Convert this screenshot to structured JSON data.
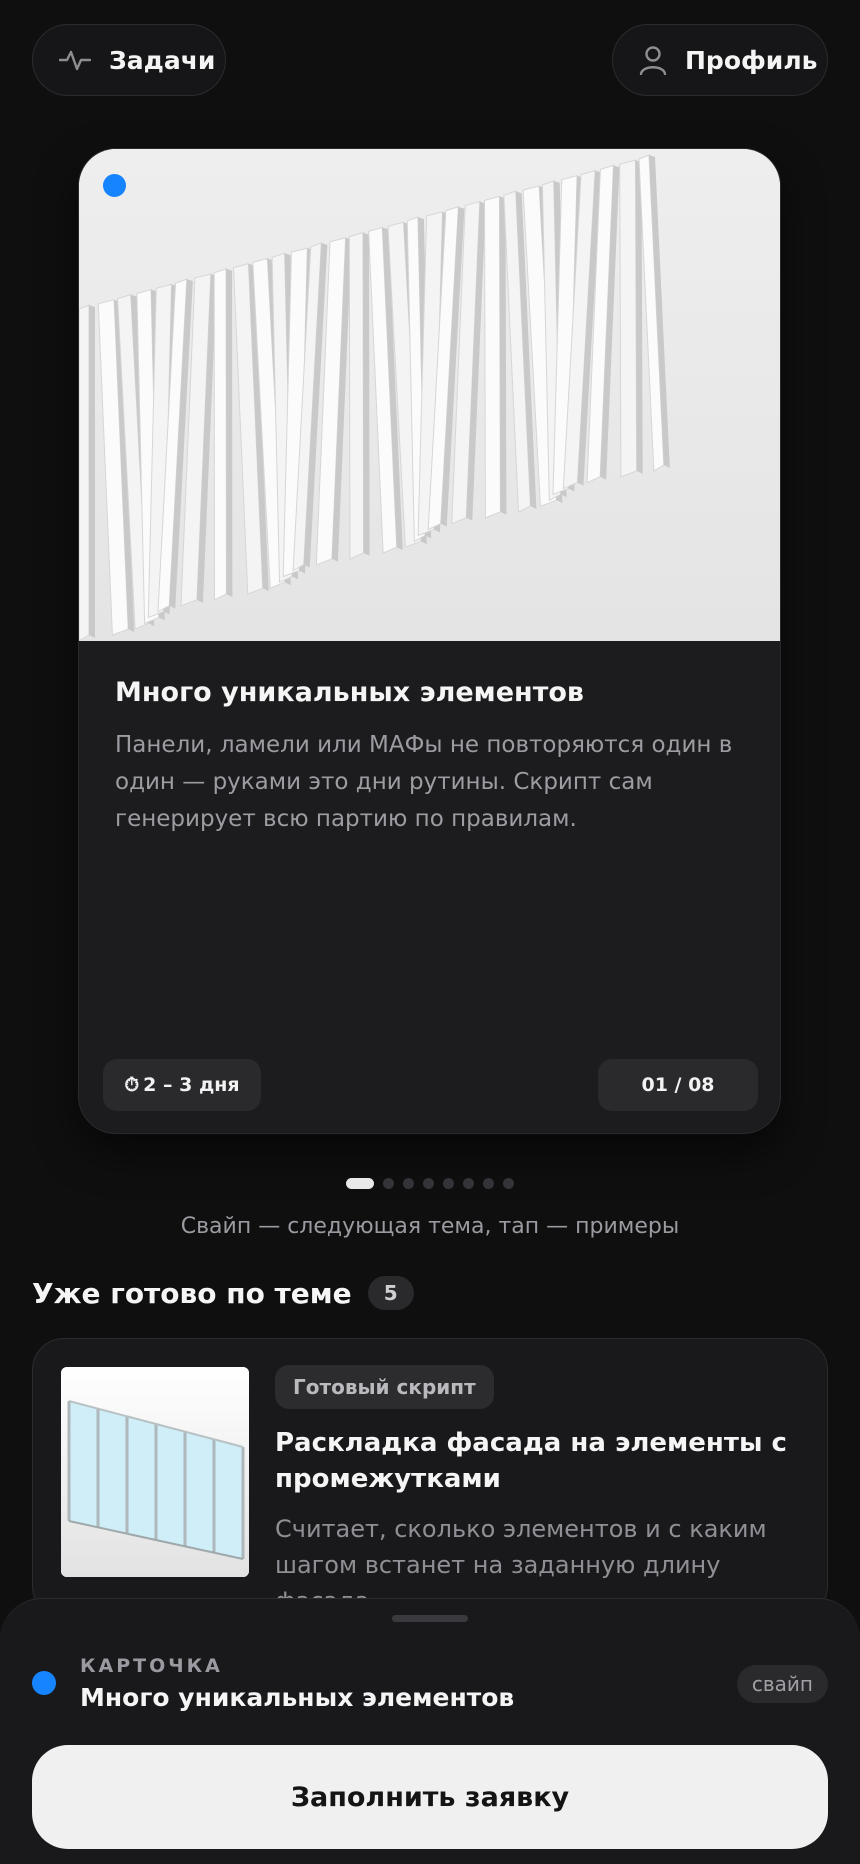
{
  "header": {
    "tasks_label": "Задачи",
    "tasks_icon": "activity-pulse-icon",
    "profile_label": "Профиль",
    "profile_icon": "user-icon"
  },
  "card": {
    "title": "Много уникальных элементов",
    "description": "Панели, ламели или МАФы не повторяются один в один — руками это дни рутины. Скрипт сам генерирует всю партию по правилам.",
    "duration": "2 – 3 дня",
    "duration_icon": "timer-icon",
    "counter": "01 / 08",
    "status_color": "#1683ff"
  },
  "pagination": {
    "total": 8,
    "active_index": 0
  },
  "hint": "Свайп — следующая тема, тап — примеры",
  "ready_section": {
    "title": "Уже готово по теме",
    "count": "5",
    "items": [
      {
        "tag": "Готовый скрипт",
        "title": "Раскладка фасада на элементы с промежутками",
        "description": "Считает, сколько элементов и с каким шагом встанет на заданную длину фасада"
      }
    ]
  },
  "sheet": {
    "kicker": "КАРТОЧКА",
    "title": "Много уникальных элементов",
    "swipe_label": "свайп",
    "cta_label": "Заполнить заявку",
    "accent_color": "#1683ff"
  }
}
